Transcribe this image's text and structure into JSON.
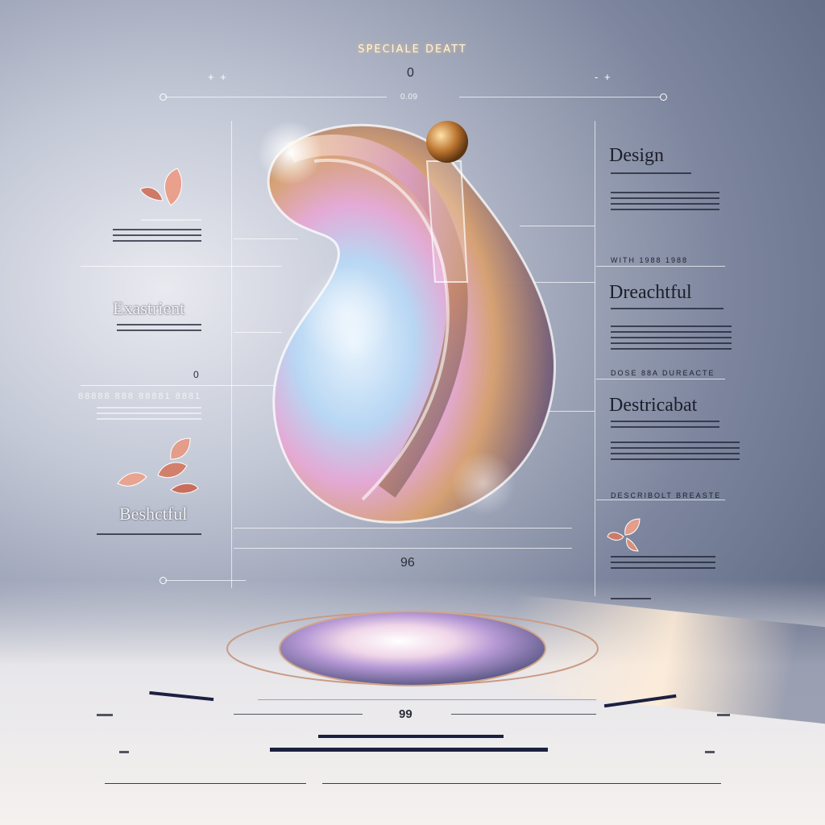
{
  "header": {
    "title": "SPECIALE DEATT",
    "top_number": "0",
    "sub_number": "0.09",
    "left_mark": "+ +",
    "right_mark": "- +"
  },
  "left_panel": {
    "heading_1": "Exastrient",
    "heading_2": "Beshctful",
    "marker_number": "0",
    "stats_label": "88888 888 88881 8881"
  },
  "right_panel": {
    "heading_1": "Design",
    "heading_2": "Dreachtful",
    "heading_3": "Destricabat",
    "footer_1": "WITH 1988  1988",
    "footer_2": "DOSE 88A  DUREACTE",
    "footer_3": "DESCRIBOLT  BREASTE"
  },
  "center": {
    "bottom_number": "96",
    "footer_number": "99"
  },
  "colors": {
    "accent_gold": "#c8955a",
    "leaf_rose": "#d98e7a",
    "line_white": "#ffffff",
    "footer_blue": "#2a3a80"
  }
}
